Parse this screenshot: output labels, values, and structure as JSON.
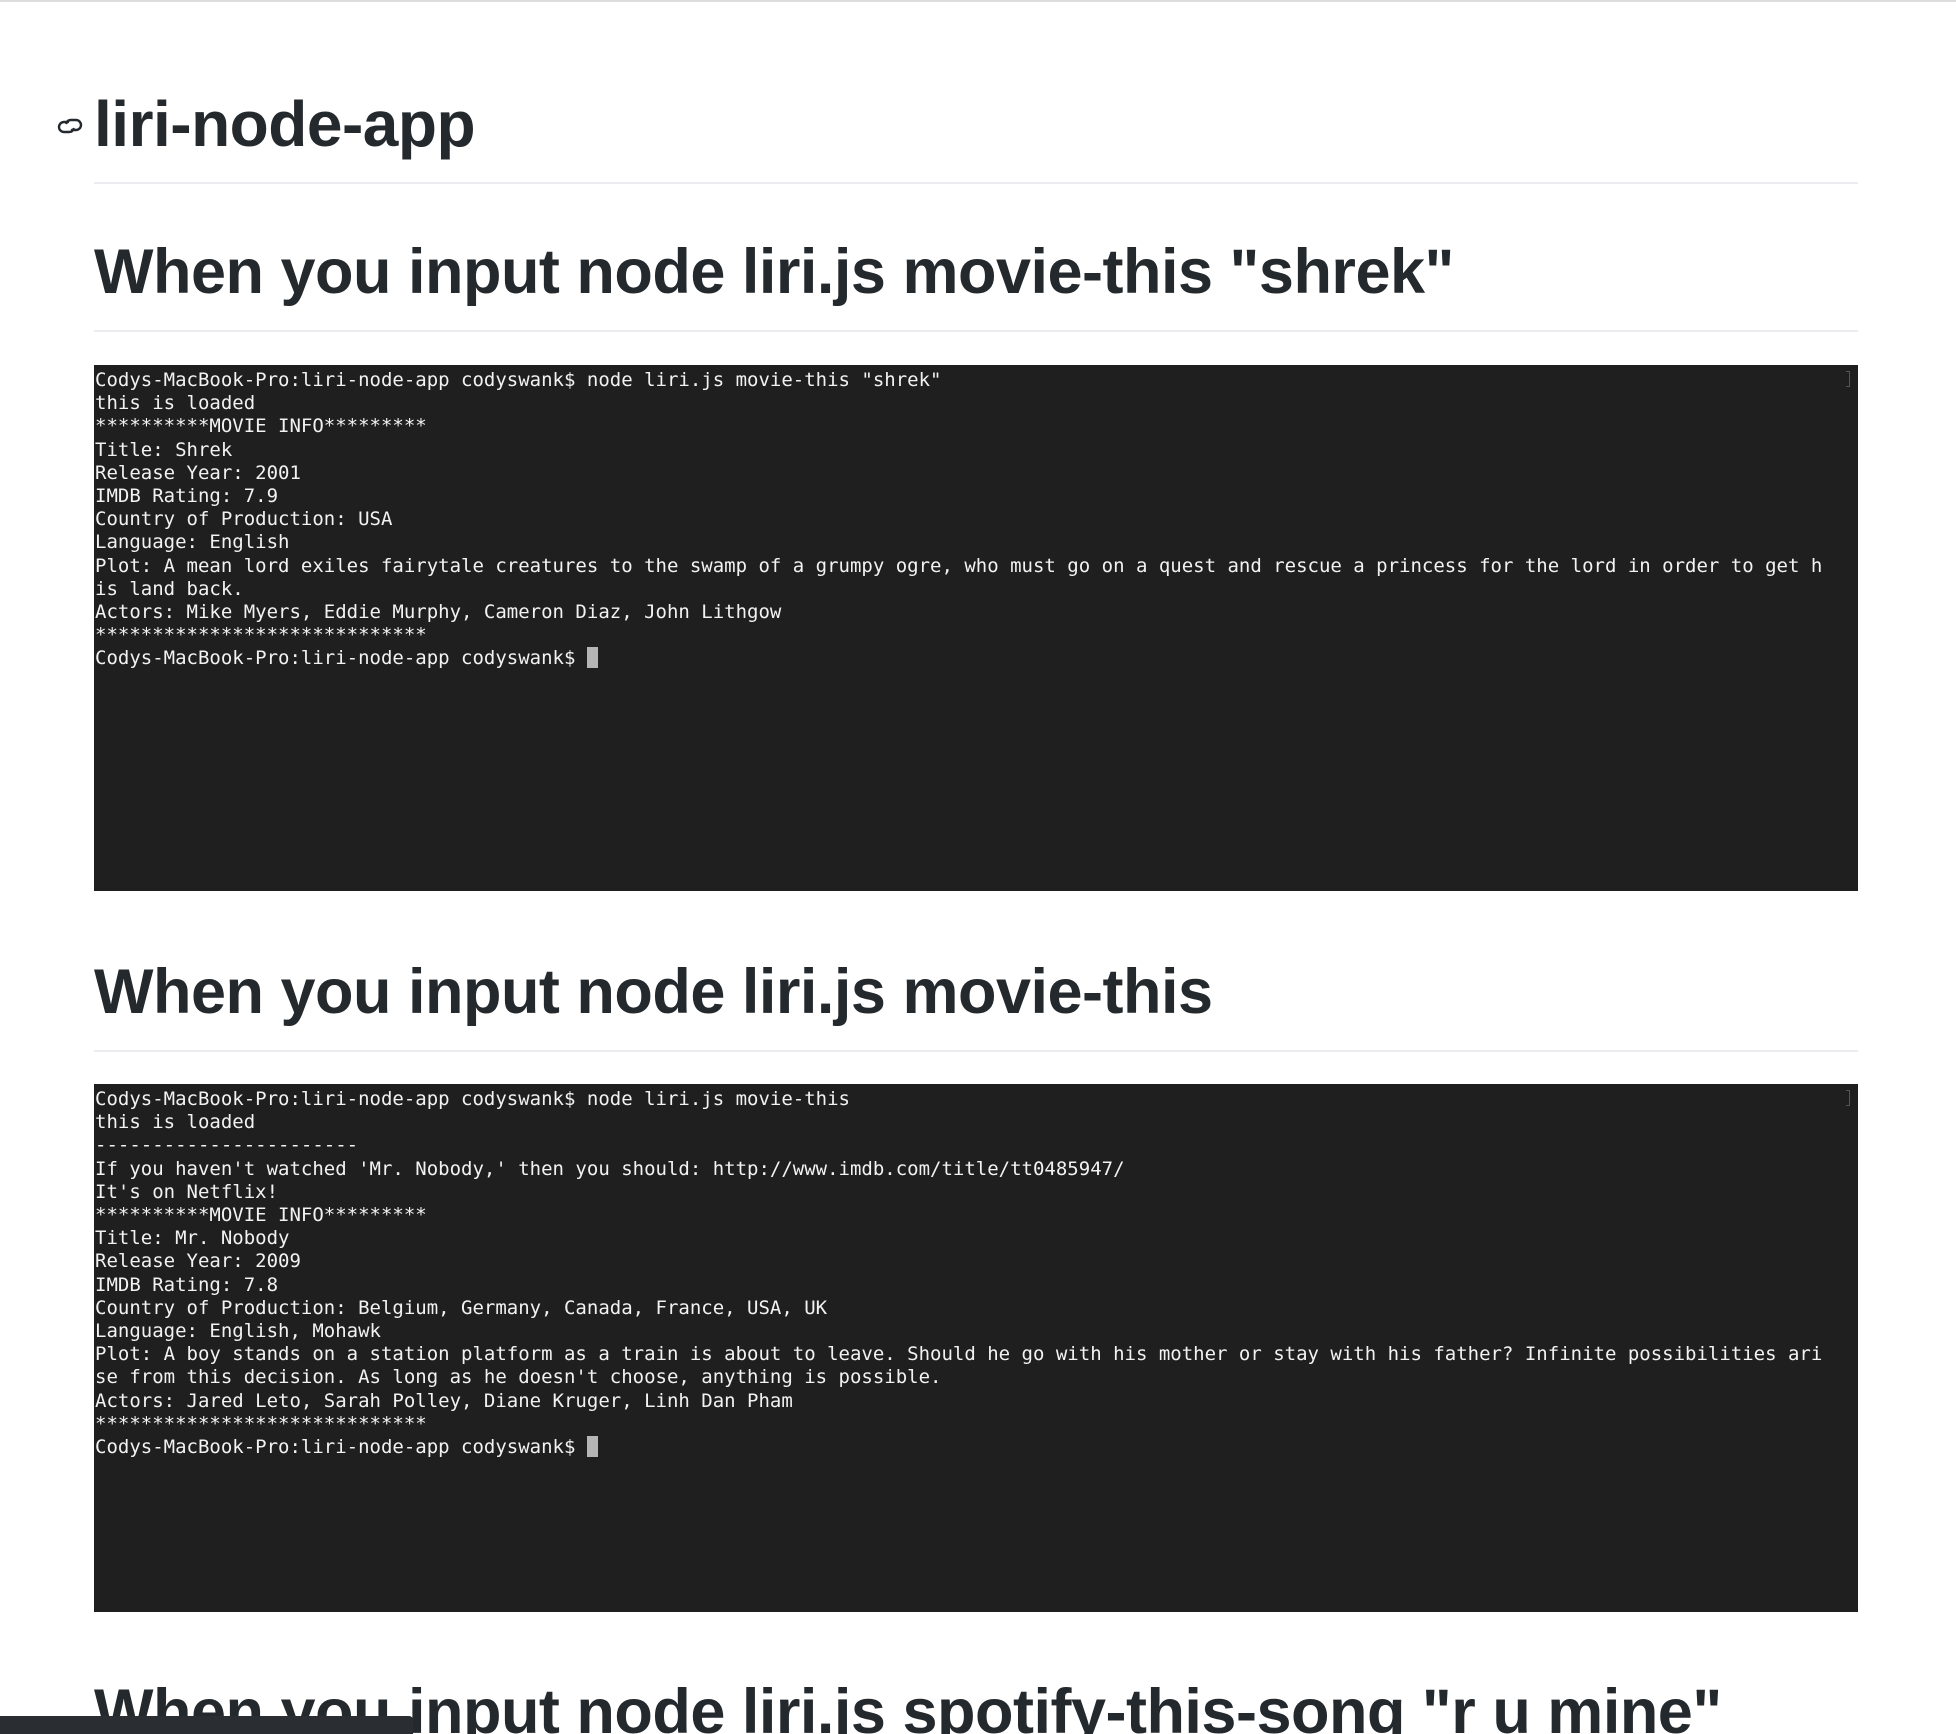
{
  "title": "liri-node-app",
  "sections": [
    {
      "heading": "When you input node liri.js movie-this \"shrek\"",
      "terminal": {
        "lines": [
          "Codys-MacBook-Pro:liri-node-app codyswank$ node liri.js movie-this \"shrek\"",
          "this is loaded",
          "**********MOVIE INFO*********",
          "Title: Shrek",
          "Release Year: 2001",
          "IMDB Rating: 7.9",
          "Country of Production: USA",
          "Language: English",
          "Plot: A mean lord exiles fairytale creatures to the swamp of a grumpy ogre, who must go on a quest and rescue a princess for the lord in order to get h",
          "is land back.",
          "Actors: Mike Myers, Eddie Murphy, Cameron Diaz, John Lithgow",
          "*****************************"
        ],
        "prompt": "Codys-MacBook-Pro:liri-node-app codyswank$ "
      }
    },
    {
      "heading": "When you input node liri.js movie-this",
      "terminal": {
        "lines": [
          "Codys-MacBook-Pro:liri-node-app codyswank$ node liri.js movie-this",
          "this is loaded",
          "-----------------------",
          "If you haven't watched 'Mr. Nobody,' then you should: http://www.imdb.com/title/tt0485947/",
          "It's on Netflix!",
          "**********MOVIE INFO*********",
          "Title: Mr. Nobody",
          "Release Year: 2009",
          "IMDB Rating: 7.8",
          "Country of Production: Belgium, Germany, Canada, France, USA, UK",
          "Language: English, Mohawk",
          "Plot: A boy stands on a station platform as a train is about to leave. Should he go with his mother or stay with his father? Infinite possibilities ari",
          "se from this decision. As long as he doesn't choose, anything is possible.",
          "Actors: Jared Leto, Sarah Polley, Diane Kruger, Linh Dan Pham",
          "*****************************"
        ],
        "prompt": "Codys-MacBook-Pro:liri-node-app codyswank$ "
      }
    },
    {
      "heading": "When you input node liri.js spotify-this-song \"r u mine\""
    }
  ],
  "icons": {
    "anchor": "link-icon"
  },
  "colors": {
    "terminal_bg": "#1f1f1f",
    "terminal_fg": "#f2f2f2",
    "heading": "#24292e",
    "rule": "#eaecef"
  }
}
